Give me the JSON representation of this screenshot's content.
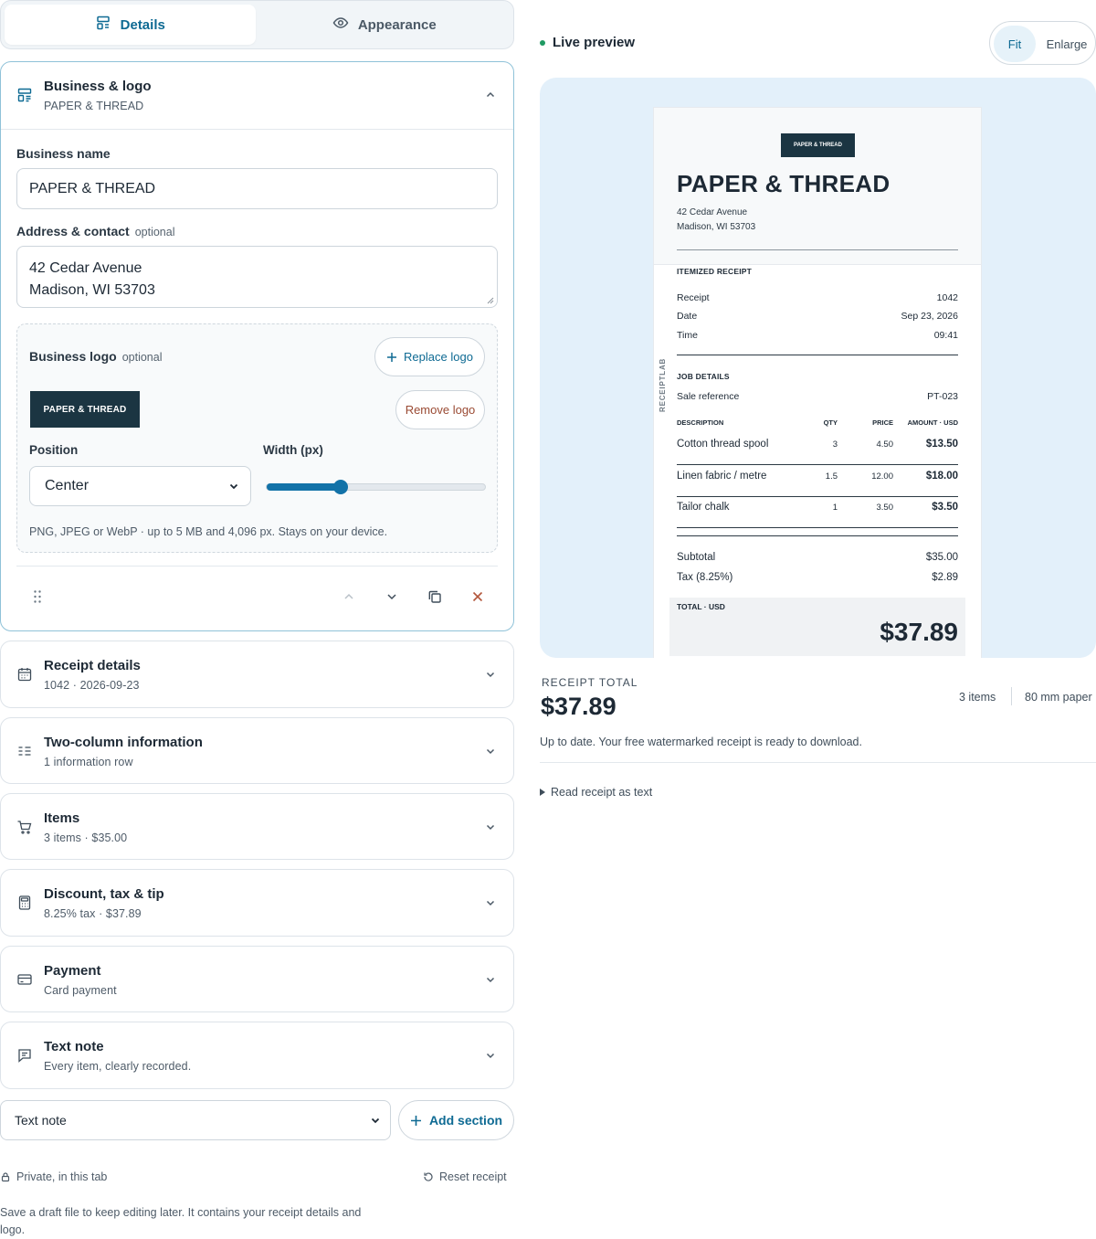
{
  "tabs": [
    {
      "label": "Details",
      "icon": "layout-icon",
      "active": true
    },
    {
      "label": "Appearance",
      "icon": "eye-icon",
      "active": false
    }
  ],
  "business": {
    "title": "Business & logo",
    "subtitle": "PAPER & THREAD",
    "name_label": "Business name",
    "name_value": "PAPER & THREAD",
    "address_label": "Address & contact",
    "address_optional": "optional",
    "address_line1": "42 Cedar Avenue",
    "address_line2": "Madison, WI 53703",
    "logo_label": "Business logo",
    "logo_optional": "optional",
    "replace_logo": "Replace logo",
    "remove_logo": "Remove logo",
    "logo_text": "PAPER & THREAD",
    "position_label": "Position",
    "position_value": "Center",
    "width_label": "Width (px)",
    "width_fraction": 0.34,
    "hint": "PNG, JPEG or WebP · up to 5 MB and 4,096 px. Stays on your device."
  },
  "sections": [
    {
      "title": "Receipt details",
      "subtitle": "1042 · 2026-09-23",
      "icon": "calendar-icon"
    },
    {
      "title": "Two-column information",
      "subtitle": "1 information row",
      "icon": "list-icon"
    },
    {
      "title": "Items",
      "subtitle": "3 items · $35.00",
      "icon": "cart-icon"
    },
    {
      "title": "Discount, tax & tip",
      "subtitle": "8.25% tax · $37.89",
      "icon": "calculator-icon"
    },
    {
      "title": "Payment",
      "subtitle": "Card payment",
      "icon": "credit-card-icon"
    },
    {
      "title": "Text note",
      "subtitle": "Every item, clearly recorded.",
      "icon": "message-icon"
    }
  ],
  "add_section": {
    "select_value": "Text note",
    "button": "Add section"
  },
  "footer": {
    "private": "Private, in this tab",
    "reset": "Reset receipt",
    "draft_note": "Save a draft file to keep editing later. It contains your receipt details and logo."
  },
  "preview": {
    "live": "Live preview",
    "fit": "Fit",
    "enlarge": "Enlarge",
    "watermark": "RECEIPTLAB",
    "receipt": {
      "logo_text": "PAPER & THREAD",
      "name": "PAPER & THREAD",
      "address_line1": "42 Cedar Avenue",
      "address_line2": "Madison, WI 53703",
      "caption": "ITEMIZED RECEIPT",
      "meta": [
        {
          "label": "Receipt",
          "value": "1042"
        },
        {
          "label": "Date",
          "value": "Sep 23, 2026"
        },
        {
          "label": "Time",
          "value": "09:41"
        }
      ],
      "job_caption": "JOB DETAILS",
      "sale_ref_label": "Sale reference",
      "sale_ref_value": "PT-023",
      "columns": {
        "desc": "DESCRIPTION",
        "qty": "QTY",
        "price": "PRICE",
        "amount": "AMOUNT · USD"
      },
      "items": [
        {
          "desc": "Cotton thread spool",
          "qty": "3",
          "price": "4.50",
          "amount": "$13.50"
        },
        {
          "desc": "Linen fabric / metre",
          "qty": "1.5",
          "price": "12.00",
          "amount": "$18.00"
        },
        {
          "desc": "Tailor chalk",
          "qty": "1",
          "price": "3.50",
          "amount": "$3.50"
        }
      ],
      "subtotal_label": "Subtotal",
      "subtotal_value": "$35.00",
      "tax_label": "Tax (8.25%)",
      "tax_value": "$2.89",
      "total_caption": "TOTAL · USD",
      "total": "$37.89"
    }
  },
  "summary": {
    "label": "RECEIPT TOTAL",
    "total": "$37.89",
    "items": "3 items",
    "paper": "80 mm paper",
    "status": "Up to date. Your free watermarked receipt is ready to download.",
    "read_as_text": "Read receipt as text"
  },
  "colors": {
    "accent": "#0e6a93",
    "danger": "#9a4a33",
    "logo_bg": "#1b3542",
    "preview_bg": "#e3f0fa"
  }
}
